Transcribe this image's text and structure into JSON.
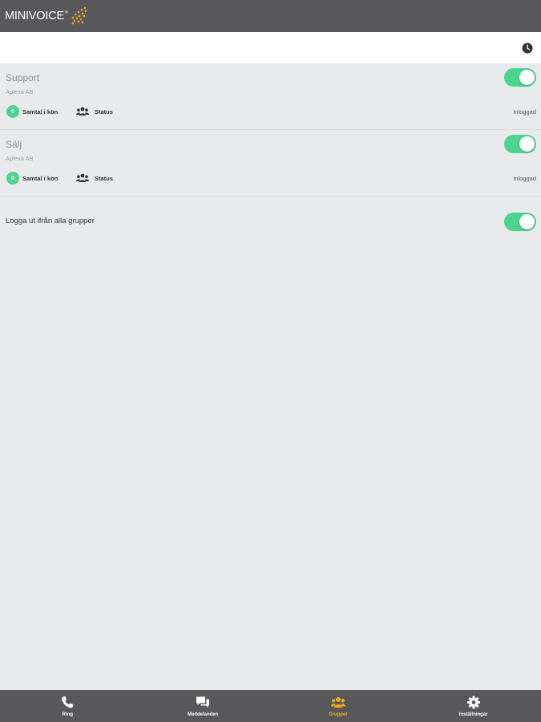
{
  "app": {
    "logo_text": "MINIVOICE",
    "logo_tm": "®"
  },
  "groups": [
    {
      "name": "Support",
      "company": "Aplexa AB",
      "queue_count": "0",
      "queue_label": "Samtal i kön",
      "status_label": "Status",
      "login_state": "Inloggad",
      "enabled": true
    },
    {
      "name": "Sälj",
      "company": "Aplexa AB",
      "queue_count": "0",
      "queue_label": "Samtal i kön",
      "status_label": "Status",
      "login_state": "Inloggad",
      "enabled": true
    }
  ],
  "logout_all": {
    "label": "Logga ut ifrån alla grupper",
    "enabled": true
  },
  "tabs": [
    {
      "label": "Ring",
      "icon": "phone-icon",
      "active": false
    },
    {
      "label": "Meddelanden",
      "icon": "chat-icon",
      "active": false
    },
    {
      "label": "Grupper",
      "icon": "group-icon",
      "active": true
    },
    {
      "label": "Inställningar",
      "icon": "gear-icon",
      "active": false
    }
  ],
  "colors": {
    "header": "#58585a",
    "toggle_on": "#4cd48c",
    "active_tab": "#f2a91e",
    "background": "#e9eaec"
  }
}
